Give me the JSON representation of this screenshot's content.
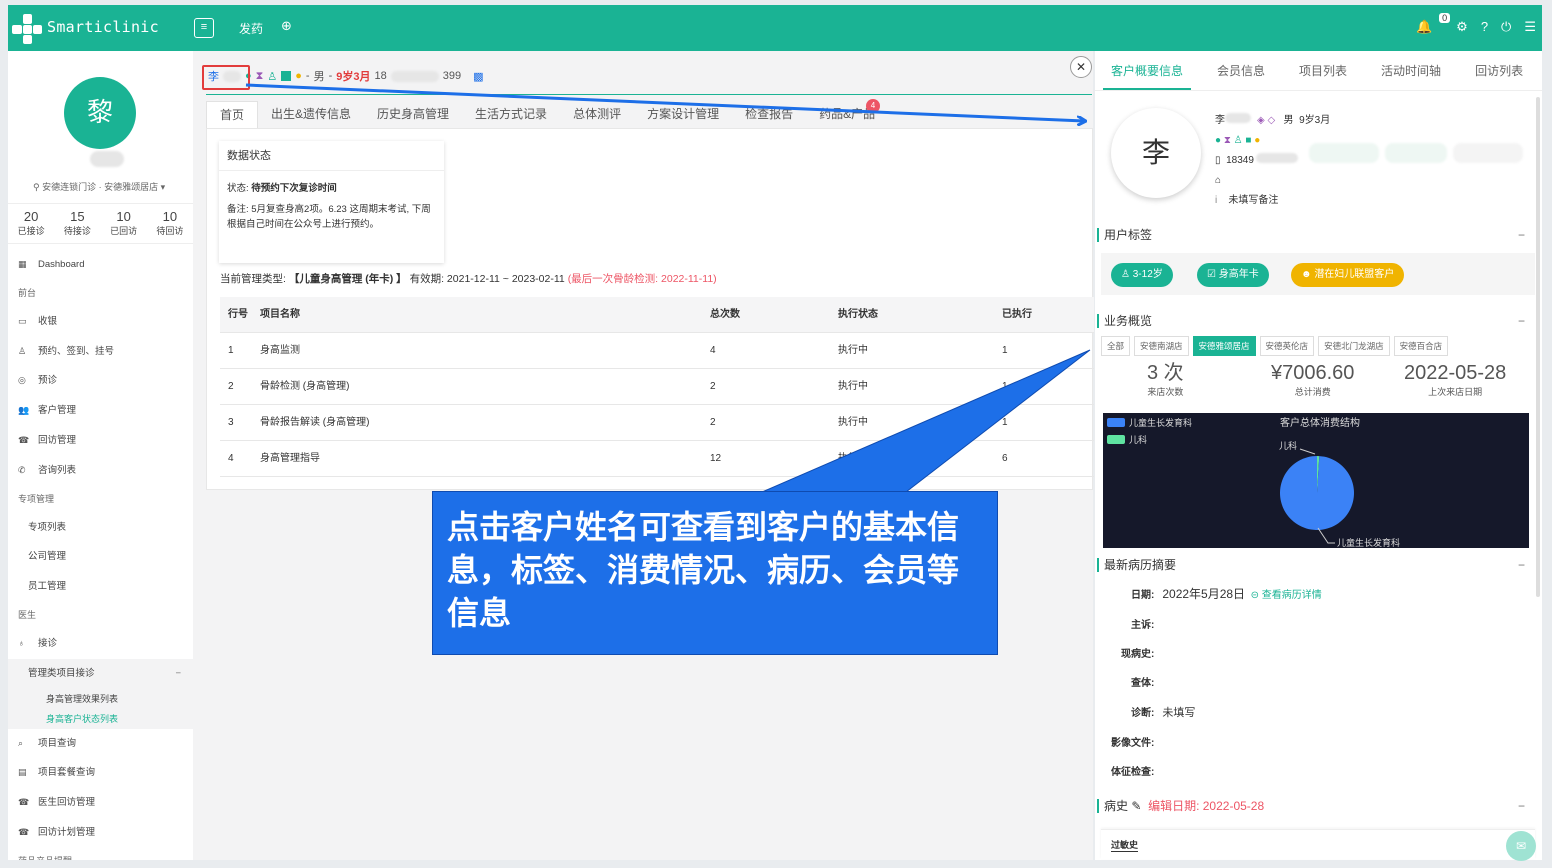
{
  "app": {
    "brand": "Smarticlinic",
    "top_tab": "发药",
    "notif_count": "0"
  },
  "sidebar": {
    "avatar_char": "黎",
    "location": "安德连锁门诊 · 安德雅颂居店",
    "stats": [
      {
        "n": "20",
        "l": "已接诊"
      },
      {
        "n": "15",
        "l": "待接诊"
      },
      {
        "n": "10",
        "l": "已回访"
      },
      {
        "n": "10",
        "l": "待回访"
      }
    ],
    "nav": {
      "dashboard": "Dashboard",
      "front": "前台",
      "cashier": "收银",
      "booking": "预约、签到、挂号",
      "triage": "预诊",
      "customers": "客户管理",
      "followup": "回访管理",
      "consult": "咨询列表",
      "special": "专项管理",
      "special_list": "专项列表",
      "company": "公司管理",
      "staff": "员工管理",
      "doctor": "医生",
      "receive": "接诊",
      "mgmt_receive": "管理类项目接诊",
      "height_effect": "身高管理效果列表",
      "height_status": "身高客户状态列表",
      "item_query": "项目查询",
      "package_query": "项目套餐查询",
      "doctor_followup": "医生回访管理",
      "followup_plan": "回访计划管理",
      "drug_reminder": "药品产品提醒"
    }
  },
  "patient": {
    "name_char": "李",
    "sex": "男",
    "age": "9岁3月",
    "phone_start": "18",
    "phone_end": "399"
  },
  "tabs": [
    "首页",
    "出生&遗传信息",
    "历史身高管理",
    "生活方式记录",
    "总体测评",
    "方案设计管理",
    "检查报告",
    "药品&产品"
  ],
  "tab_badge": "4",
  "data_status": {
    "title": "数据状态",
    "status_label": "状态:",
    "status_value": "待预约下次复诊时间",
    "note": "备注: 5月复查身高2项。6.23 这周期末考试, 下周根据自己时间在公众号上进行预约。"
  },
  "mgmt": {
    "prefix": "当前管理类型:",
    "type": "【儿童身高管理 (年卡) 】",
    "validity": "有效期: 2021-12-11 ~ 2023-02-11",
    "bone_check": "(最后一次骨龄检测: 2022-11-11)"
  },
  "table": {
    "headers": [
      "行号",
      "项目名称",
      "总次数",
      "执行状态",
      "已执行"
    ],
    "rows": [
      [
        "1",
        "身高监测",
        "4",
        "执行中",
        "1"
      ],
      [
        "2",
        "骨龄检测 (身高管理)",
        "2",
        "执行中",
        "1"
      ],
      [
        "3",
        "骨龄报告解读 (身高管理)",
        "2",
        "执行中",
        "1"
      ],
      [
        "4",
        "身高管理指导",
        "12",
        "执行中",
        "6"
      ]
    ]
  },
  "right_panel": {
    "tabs": [
      "客户概要信息",
      "会员信息",
      "项目列表",
      "活动时间轴",
      "回访列表"
    ],
    "avatar_char": "李",
    "name": "李",
    "sex": "男",
    "age": "9岁3月",
    "phone": "18349",
    "remark": "未填写备注",
    "user_tags_title": "用户标签",
    "tags": [
      "3-12岁",
      "身高年卡",
      "潜在妇儿联盟客户"
    ],
    "business_title": "业务概览",
    "stores": [
      "全部",
      "安德南湖店",
      "安德雅颂居店",
      "安德英伦店",
      "安德北门龙湖店",
      "安德百合店"
    ],
    "stats": [
      {
        "n": "3 次",
        "l": "来店次数"
      },
      {
        "n": "¥7006.60",
        "l": "总计消费"
      },
      {
        "n": "2022-05-28",
        "l": "上次来店日期"
      }
    ],
    "chart_legend": [
      "儿童生长发育科",
      "儿科"
    ],
    "chart_title": "客户总体消费结构",
    "record_title": "最新病历摘要",
    "record": {
      "date_label": "日期:",
      "date": "2022年5月28日",
      "detail_link": "查看病历详情",
      "complaint": "主诉:",
      "history": "现病史:",
      "exam": "查体:",
      "diagnosis": "诊断:",
      "diagnosis_value": "未填写",
      "imaging": "影像文件:",
      "vitals": "体征检查:"
    },
    "history_title": "病史",
    "edit_date": "编辑日期: 2022-05-28",
    "allergy": "过敏史"
  },
  "chart_data": {
    "type": "pie",
    "title": "客户总体消费结构",
    "categories": [
      "儿童生长发育科",
      "儿科"
    ],
    "values": [
      99,
      1
    ],
    "colors": [
      "#3b82f6",
      "#5fe3a1"
    ],
    "legend": "top-left"
  },
  "callout": {
    "text": "点击客户姓名可查看到客户的基本信息，标签、消费情况、病历、会员等信息"
  }
}
